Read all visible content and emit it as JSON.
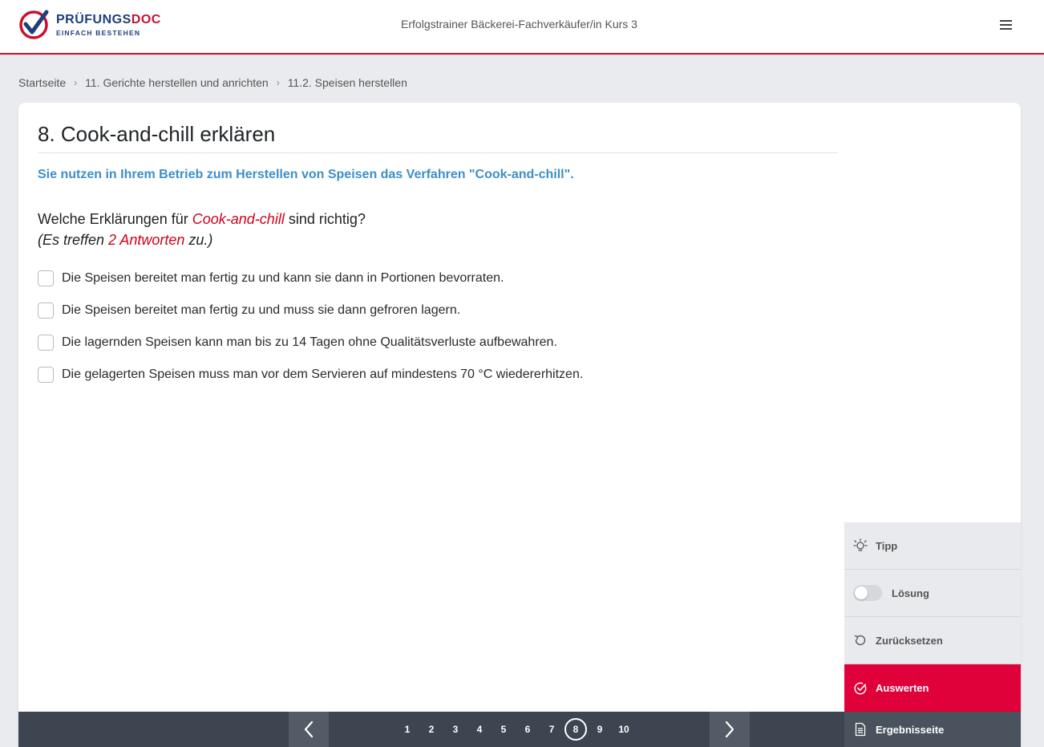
{
  "header": {
    "brand_main": "PRÜFUNGS",
    "brand_accent": "DOC",
    "tagline": "EINFACH BESTEHEN",
    "course_title": "Erfolgstrainer Bäckerei-Fachverkäufer/in Kurs 3"
  },
  "breadcrumb": {
    "items": [
      "Startseite",
      "11. Gerichte herstellen und anrichten",
      "11.2. Speisen herstellen"
    ],
    "separator": ">"
  },
  "exercise": {
    "title": "8. Cook-and-chill erklären",
    "scenario": "Sie nutzen in Ihrem Betrieb zum Herstellen von Speisen das Verfahren \"Cook-and-chill\".",
    "question_prefix": "Welche Erklärungen für ",
    "question_highlight": "Cook-and-chill",
    "question_suffix": " sind richtig?",
    "hint_prefix": "(Es treffen ",
    "hint_highlight": "2 Antworten",
    "hint_suffix": " zu.)",
    "answers": [
      "Die Speisen bereitet man fertig zu und kann sie dann in Portionen bevorraten.",
      "Die Speisen bereitet man fertig zu und muss sie dann gefroren lagern.",
      "Die lagernden Speisen kann man bis zu 14 Tagen ohne Qualitätsverluste aufbewahren.",
      "Die gelagerten Speisen muss man vor dem Servieren auf mindestens 70 °C wiedererhitzen."
    ]
  },
  "pagination": {
    "pages": [
      "1",
      "2",
      "3",
      "4",
      "5",
      "6",
      "7",
      "8",
      "9",
      "10"
    ],
    "current": "8"
  },
  "side_panel": {
    "tip": "Tipp",
    "solution": "Lösung",
    "reset": "Zurücksetzen",
    "evaluate": "Auswerten",
    "results": "Ergebnisseite"
  },
  "colors": {
    "accent": "#c8102e",
    "evaluate_bg": "#e0003a",
    "scenario_text": "#3d8fc9",
    "nav_bar": "#3c4550"
  }
}
